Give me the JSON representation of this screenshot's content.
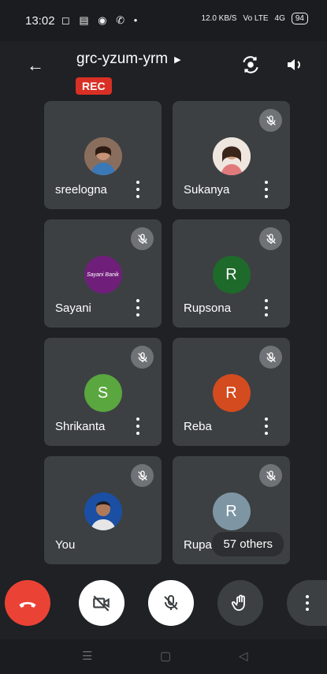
{
  "status": {
    "time": "13:02",
    "left_icons": "◻ ▤ ◉ ✆ •",
    "net_speed": "12.0 KB/S",
    "volte": "Vo LTE",
    "signal": "4G",
    "battery": "94"
  },
  "header": {
    "meeting_code": "grc-yzum-yrm",
    "rec_label": "REC"
  },
  "participants": [
    {
      "name": "sreelogna",
      "muted": false,
      "avatar_type": "photo",
      "avatar_bg": "#6b4b3b"
    },
    {
      "name": "Sukanya",
      "muted": true,
      "avatar_type": "photo",
      "avatar_bg": "#e8d9cf"
    },
    {
      "name": "Sayani",
      "muted": true,
      "avatar_type": "logo",
      "avatar_text": "Sayani Banik",
      "avatar_bg": "#6f1f7a"
    },
    {
      "name": "Rupsona",
      "muted": true,
      "avatar_type": "letter",
      "initial": "R",
      "avatar_bg": "#1e6a2b"
    },
    {
      "name": "Shrikanta",
      "muted": true,
      "avatar_type": "letter",
      "initial": "S",
      "avatar_bg": "#5aa63f"
    },
    {
      "name": "Reba",
      "muted": true,
      "avatar_type": "letter",
      "initial": "R",
      "avatar_bg": "#d44b1f"
    },
    {
      "name": "You",
      "muted": true,
      "avatar_type": "photo",
      "avatar_bg": "#1a4fa3"
    },
    {
      "name": "Rupa",
      "muted": true,
      "avatar_type": "letter",
      "initial": "R",
      "avatar_bg": "#7e96a4"
    }
  ],
  "others_label": "57 others",
  "colors": {
    "background": "#1f2124",
    "tile": "#3c4043",
    "end_call": "#ea4335",
    "rec": "#d93025"
  },
  "controls": [
    "end-call",
    "camera-off",
    "mic-off",
    "raise-hand",
    "more"
  ]
}
